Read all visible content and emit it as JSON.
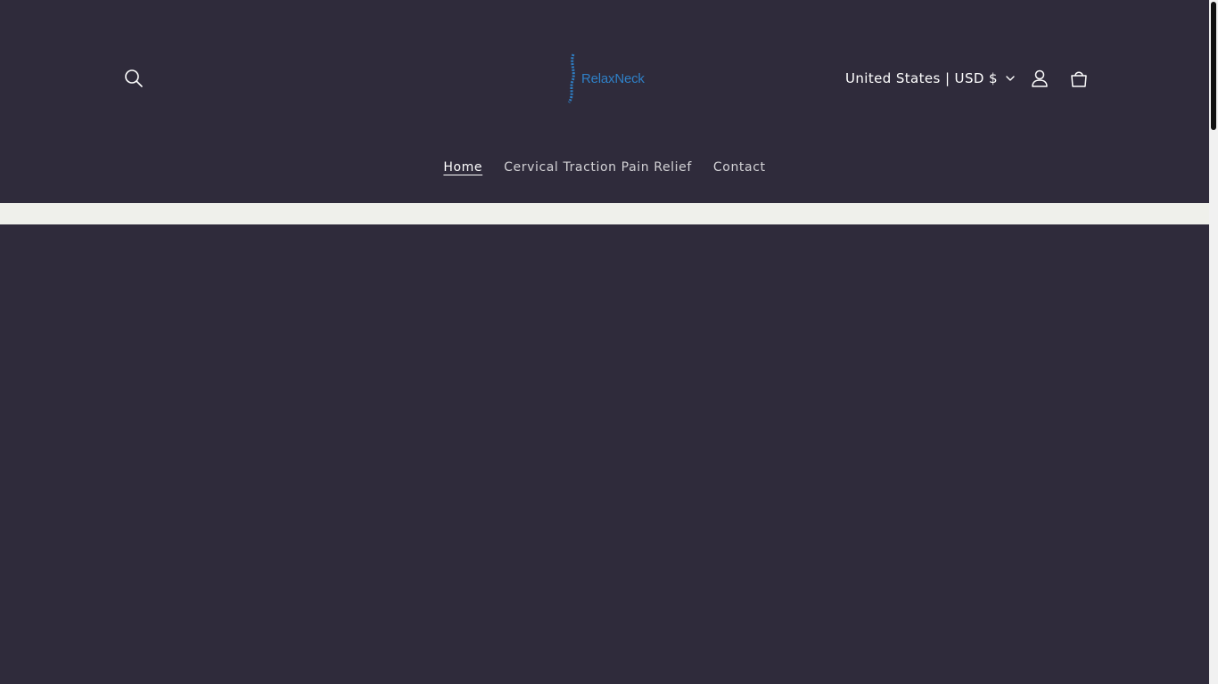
{
  "header": {
    "logo_text": "RelaxNeck",
    "locale_label": "United States | USD $",
    "icons": {
      "search": "search-icon",
      "account": "account-icon",
      "cart": "cart-icon",
      "caret": "chevron-down-icon"
    }
  },
  "nav": {
    "items": [
      {
        "label": "Home",
        "active": true
      },
      {
        "label": "Cervical Traction Pain Relief",
        "active": false
      },
      {
        "label": "Contact",
        "active": false
      }
    ]
  },
  "colors": {
    "background": "#2f2b3b",
    "band": "#eff0eb",
    "logo": "#2f7fc5",
    "text": "#ffffff"
  }
}
